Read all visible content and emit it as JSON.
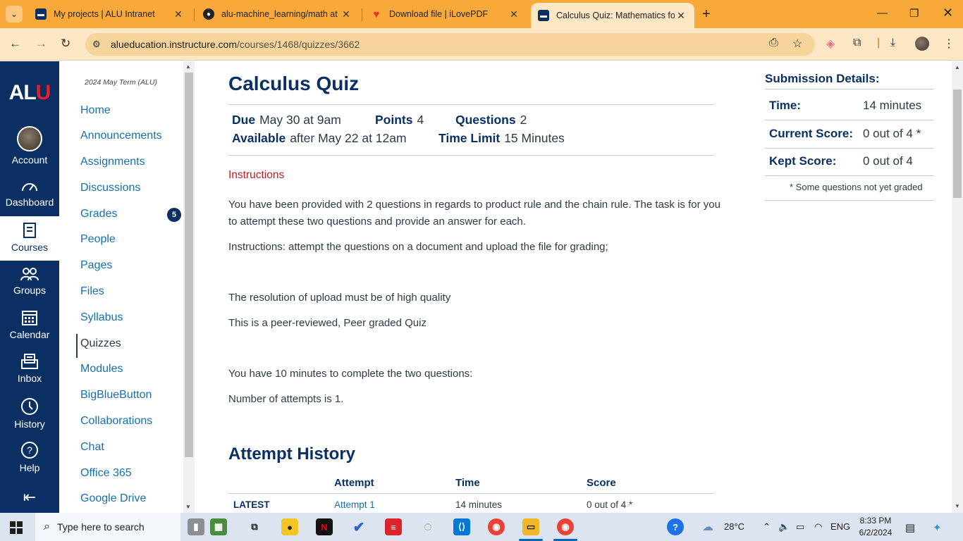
{
  "browser": {
    "tabs": [
      {
        "title": "My projects | ALU Intranet",
        "icon": "alu-icon"
      },
      {
        "title": "alu-machine_learning/math at m",
        "icon": "github-icon"
      },
      {
        "title": "Download file | iLovePDF",
        "icon": "heart-pdf-icon"
      },
      {
        "title": "Calculus Quiz: Mathematics for",
        "icon": "canvas-icon",
        "active": true
      }
    ],
    "url_host": "alueducation.instructure.com",
    "url_path": "/courses/1468/quizzes/3662"
  },
  "global_nav": {
    "logo_left": "AL",
    "logo_right": "U",
    "items": [
      {
        "label": "Account",
        "icon": "account-avatar"
      },
      {
        "label": "Dashboard",
        "icon": "dashboard-icon"
      },
      {
        "label": "Courses",
        "icon": "courses-icon",
        "active": true
      },
      {
        "label": "Groups",
        "icon": "groups-icon"
      },
      {
        "label": "Calendar",
        "icon": "calendar-icon"
      },
      {
        "label": "Inbox",
        "icon": "inbox-icon"
      },
      {
        "label": "History",
        "icon": "history-icon"
      },
      {
        "label": "Help",
        "icon": "help-icon"
      }
    ]
  },
  "course_nav": {
    "term": "2024 May Term (ALU)",
    "items": [
      "Home",
      "Announcements",
      "Assignments",
      "Discussions",
      "Grades",
      "People",
      "Pages",
      "Files",
      "Syllabus",
      "Quizzes",
      "Modules",
      "BigBlueButton",
      "Collaborations",
      "Chat",
      "Office 365",
      "Google Drive"
    ],
    "active": "Quizzes",
    "grades_badge": "5"
  },
  "quiz": {
    "title": "Calculus Quiz",
    "due_label": "Due",
    "due": "May 30 at 9am",
    "points_label": "Points",
    "points": "4",
    "questions_label": "Questions",
    "questions": "2",
    "available_label": "Available",
    "available": "after May 22 at 12am",
    "time_limit_label": "Time Limit",
    "time_limit": "15 Minutes",
    "instructions_heading": "Instructions",
    "paragraphs": [
      "You have been provided with 2 questions in regards to product rule and the chain rule. The task is for you to attempt these two questions and provide an answer for each.",
      "Instructions: attempt the questions on a document and upload the file for grading;",
      "The resolution of upload must be of high quality",
      "This is a peer-reviewed, Peer graded Quiz",
      "You have 10 minutes to complete the two questions:",
      "Number of attempts is 1."
    ]
  },
  "attempt_history": {
    "title": "Attempt History",
    "headers": [
      "Attempt",
      "Time",
      "Score"
    ],
    "rows": [
      {
        "label": "LATEST",
        "attempt": "Attempt 1",
        "time": "14 minutes",
        "score": "0 out of 4 *"
      }
    ]
  },
  "submission": {
    "title": "Submission Details:",
    "time_label": "Time:",
    "time": "14 minutes",
    "current_label": "Current Score:",
    "current": "0 out of 4 *",
    "kept_label": "Kept Score:",
    "kept": "0 out of 4",
    "note": "* Some questions not yet graded"
  },
  "taskbar": {
    "search_placeholder": "Type here to search",
    "weather": "28°C",
    "language": "ENG",
    "time": "8:33 PM",
    "date": "6/2/2024"
  },
  "colors": {
    "brand": "#0a2f63",
    "link": "#1770ab",
    "accent_red": "#b8202b",
    "tab_orange": "#f9a93a"
  }
}
